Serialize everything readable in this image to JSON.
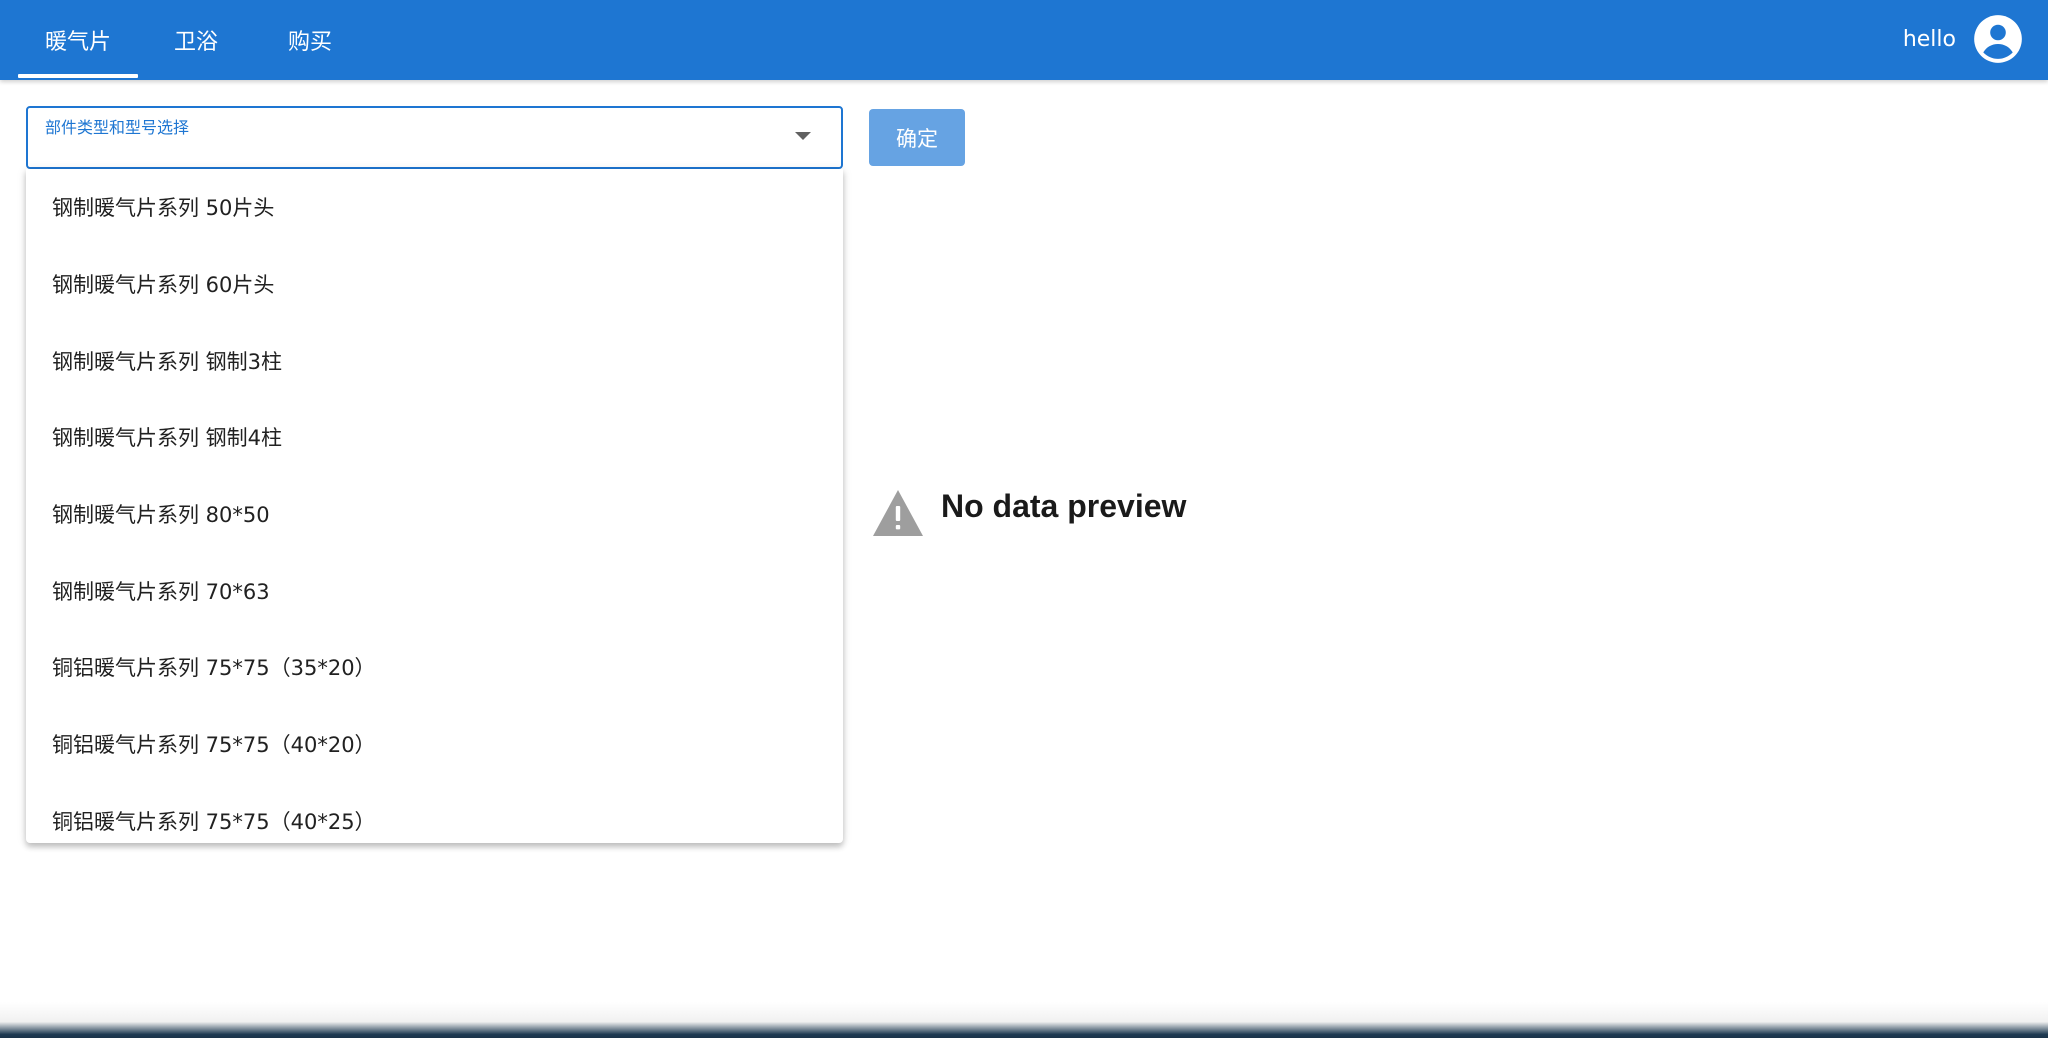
{
  "header": {
    "tabs": [
      {
        "label": "暖气片",
        "active": true
      },
      {
        "label": "卫浴",
        "active": false
      },
      {
        "label": "购买",
        "active": false
      }
    ],
    "user_name": "hello",
    "avatar_icon": "account-circle-icon",
    "bar_color": "#1e76d2"
  },
  "selector": {
    "label": "部件类型和型号选择",
    "value": "",
    "caret_icon": "chevron-down-icon",
    "options": [
      "钢制暖气片系列 50片头",
      "钢制暖气片系列 60片头",
      "钢制暖气片系列 钢制3柱",
      "钢制暖气片系列 钢制4柱",
      "钢制暖气片系列 80*50",
      "钢制暖气片系列 70*63",
      "铜铝暖气片系列 75*75（35*20）",
      "铜铝暖气片系列 75*75（40*20）",
      "铜铝暖气片系列 75*75（40*25）"
    ]
  },
  "confirm_button": {
    "label": "确定",
    "color": "#66a3e3"
  },
  "preview": {
    "icon": "warning-icon",
    "message": "No data preview"
  }
}
